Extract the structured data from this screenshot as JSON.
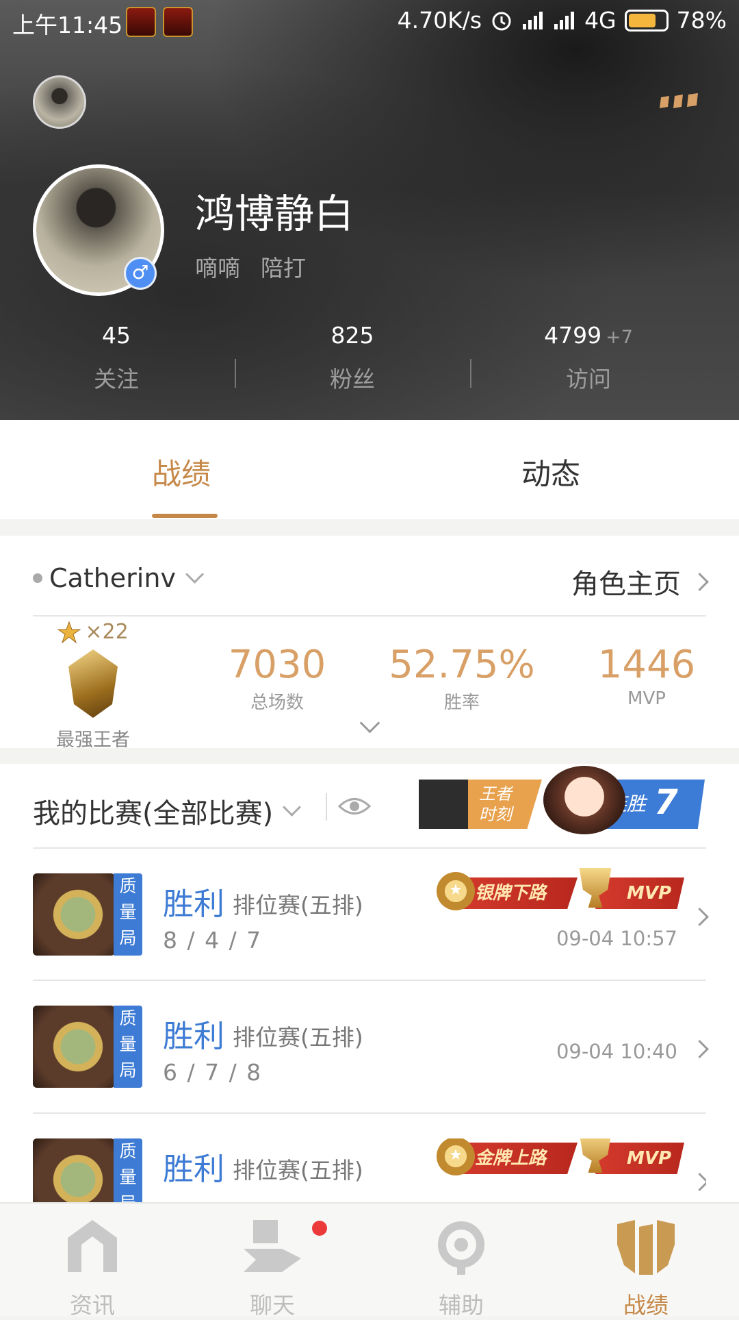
{
  "status_bar": {
    "time": "上午11:45",
    "speed": "4.70K/s",
    "network": "4G",
    "battery_level": 0.78,
    "battery_text": "78%"
  },
  "profile": {
    "username": "鸿博静白",
    "tags": [
      "嘀嘀",
      "陪打"
    ],
    "gender_symbol": "♂",
    "stats": [
      {
        "value": "45",
        "label": "关注"
      },
      {
        "value": "825",
        "label": "粉丝"
      },
      {
        "value": "4799",
        "extra": "+7",
        "label": "访问"
      }
    ]
  },
  "tabs": {
    "active": "战绩",
    "other": "动态"
  },
  "role": {
    "name": "Catherinv",
    "link_label": "角色主页",
    "star_multiplier": "×22",
    "rank_name": "最强王者",
    "stats": [
      {
        "value": "7030",
        "label": "总场数"
      },
      {
        "value": "52.75%",
        "label": "胜率"
      },
      {
        "value": "1446",
        "label": "MVP"
      }
    ]
  },
  "matches_section": {
    "title": "我的比赛(全部比赛)",
    "banner_left_text": [
      "王者",
      "时刻"
    ],
    "banner_right_text": "连胜",
    "banner_right_num": "7"
  },
  "matches": [
    {
      "badge": "质量局",
      "result": "胜利",
      "mode": "排位赛(五排)",
      "kda": "8 / 4 / 7",
      "time": "09-04 10:57",
      "medal": "银牌下路",
      "mvp": "MVP"
    },
    {
      "badge": "质量局",
      "result": "胜利",
      "mode": "排位赛(五排)",
      "kda": "6 / 7 / 8",
      "time": "09-04 10:40"
    },
    {
      "badge": "质量局",
      "result": "胜利",
      "mode": "排位赛(五排)",
      "medal": "金牌上路",
      "mvp": "MVP"
    }
  ],
  "bottom_nav": [
    {
      "label": "资讯",
      "icon": "news-icon"
    },
    {
      "label": "聊天",
      "icon": "chat-icon"
    },
    {
      "label": "辅助",
      "icon": "assist-icon"
    },
    {
      "label": "战绩",
      "icon": "record-icon"
    }
  ],
  "colors": {
    "accent": "#c68848",
    "win_blue": "#3d7bd4",
    "stat_gold": "#d8a066",
    "unread_red": "#ec3a3a"
  }
}
